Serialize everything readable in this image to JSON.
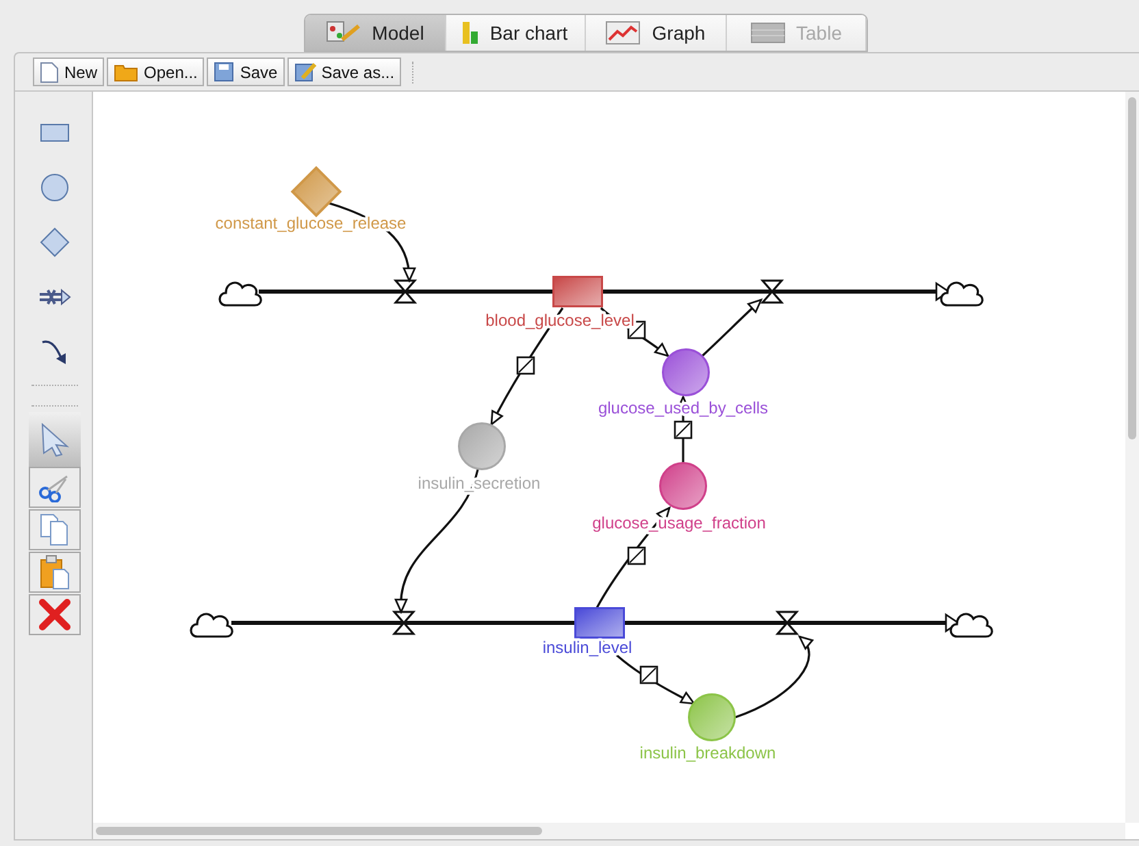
{
  "tabs": [
    {
      "label": "Model",
      "selected": true,
      "disabled": false
    },
    {
      "label": "Bar chart",
      "selected": false,
      "disabled": false
    },
    {
      "label": "Graph",
      "selected": false,
      "disabled": false
    },
    {
      "label": "Table",
      "selected": false,
      "disabled": true
    }
  ],
  "toolbar": [
    {
      "kind": "new",
      "label": "New"
    },
    {
      "kind": "open",
      "label": "Open..."
    },
    {
      "kind": "save",
      "label": "Save"
    },
    {
      "kind": "saveas",
      "label": "Save as..."
    }
  ],
  "palette": [
    {
      "kind": "stock",
      "selected": false
    },
    {
      "kind": "auxiliary",
      "selected": false
    },
    {
      "kind": "constant",
      "selected": false
    },
    {
      "kind": "flow",
      "selected": false
    },
    {
      "kind": "link",
      "selected": false
    },
    {
      "kind": "separator"
    },
    {
      "kind": "pointer",
      "selected": true
    },
    {
      "kind": "cut",
      "selected": false
    },
    {
      "kind": "copy",
      "selected": false
    },
    {
      "kind": "paste",
      "selected": false
    },
    {
      "kind": "delete",
      "selected": false
    }
  ],
  "diagram": {
    "nodes": [
      {
        "kind": "constant",
        "label": "constant_glucose_release",
        "color": "#d09848"
      },
      {
        "kind": "stock",
        "label": "blood_glucose_level",
        "color": "#c84848"
      },
      {
        "kind": "auxiliary",
        "label": "glucose_used_by_cells",
        "color": "#9a50d8"
      },
      {
        "kind": "auxiliary",
        "label": "insulin_secretion",
        "color": "#a8a8a8"
      },
      {
        "kind": "auxiliary",
        "label": "glucose_usage_fraction",
        "color": "#d0408a"
      },
      {
        "kind": "stock",
        "label": "insulin_level",
        "color": "#4a4ad8"
      },
      {
        "kind": "auxiliary",
        "label": "insulin_breakdown",
        "color": "#8cc448"
      }
    ]
  }
}
